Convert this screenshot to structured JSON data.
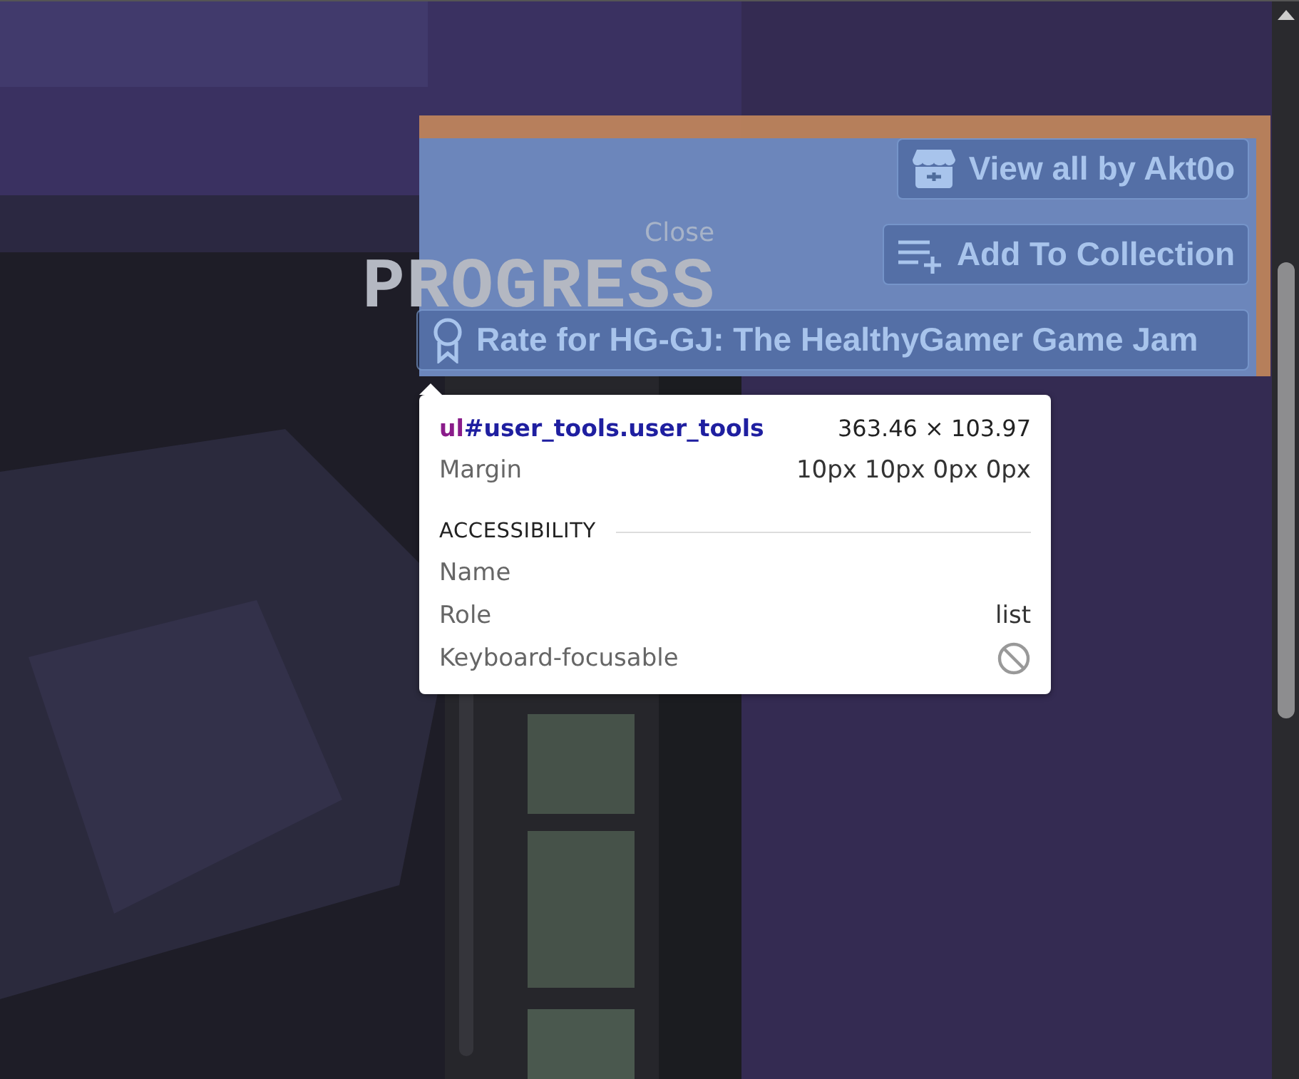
{
  "game": {
    "close_label": "Close",
    "title": "PROGRESS"
  },
  "highlight": {
    "buttons": [
      {
        "kind": "store",
        "label": "View all by Akt0o"
      },
      {
        "kind": "collection",
        "label": "Add To Collection"
      },
      {
        "kind": "rate",
        "label": "Rate for HG-GJ: The HealthyGamer Game Jam"
      }
    ]
  },
  "tooltip": {
    "tag": "ul",
    "selector": "#user_tools.user_tools",
    "size": "363.46 × 103.97",
    "margin_label": "Margin",
    "margin_value": "10px 10px 0px 0px",
    "section": "ACCESSIBILITY",
    "rows": [
      {
        "label": "Name"
      },
      {
        "label": "Role",
        "value": "list"
      },
      {
        "label": "Keyboard-focusable",
        "focusable": false
      }
    ]
  }
}
